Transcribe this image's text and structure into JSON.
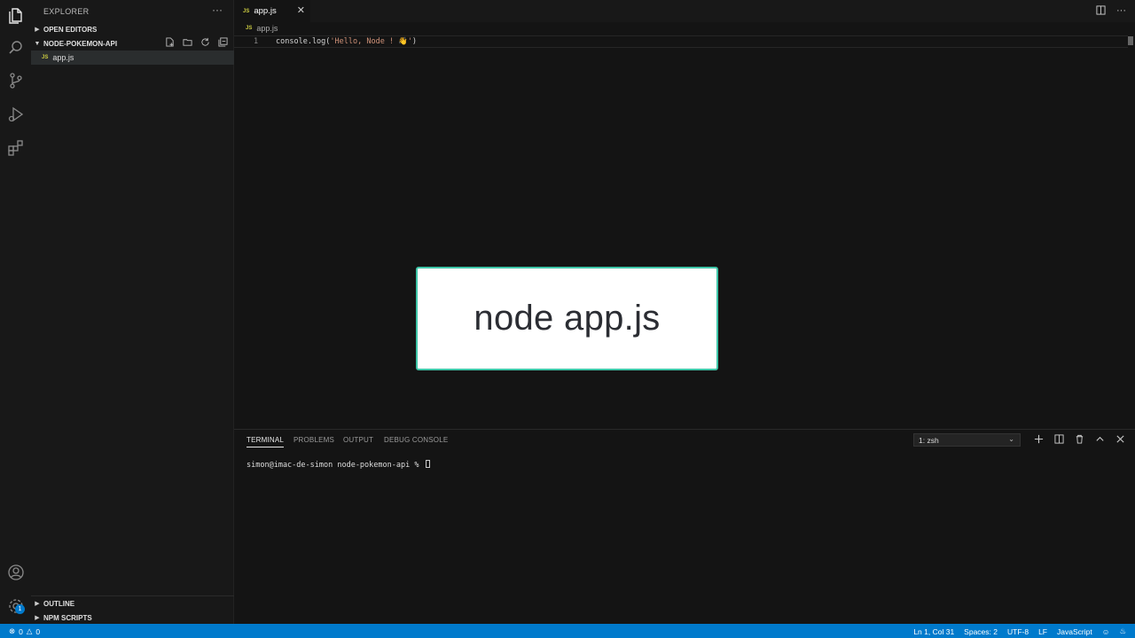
{
  "activity_bar": {
    "icons": [
      "files-icon",
      "search-icon",
      "source-control-icon",
      "run-debug-icon",
      "extensions-icon",
      "account-icon",
      "settings-gear-icon"
    ],
    "settings_badge": "1"
  },
  "sidebar": {
    "title": "EXPLORER",
    "more_actions": "···",
    "open_editors": "OPEN EDITORS",
    "project": "NODE-POKEMON-API",
    "files": [
      {
        "badge": "JS",
        "name": "app.js"
      }
    ],
    "outline": "OUTLINE",
    "npm_scripts": "NPM SCRIPTS"
  },
  "editor": {
    "tab": {
      "badge": "JS",
      "name": "app.js",
      "close": "✕"
    },
    "breadcrumb": {
      "badge": "JS",
      "name": "app.js"
    },
    "line_number": "1",
    "code": {
      "prefix": "console.log(",
      "string": "'Hello, Node ! 👋'",
      "suffix": ")"
    }
  },
  "overlay": {
    "text": "node app.js"
  },
  "panel": {
    "tabs": [
      "TERMINAL",
      "PROBLEMS",
      "OUTPUT",
      "DEBUG CONSOLE"
    ],
    "active_tab": "TERMINAL",
    "shell": "1: zsh",
    "prompt": "simon@imac-de-simon node-pokemon-api % "
  },
  "status_bar": {
    "errors": "0",
    "warnings": "0",
    "position": "Ln 1, Col 31",
    "spaces": "Spaces: 2",
    "encoding": "UTF-8",
    "eol": "LF",
    "language": "JavaScript"
  },
  "colors": {
    "accent": "#007acc",
    "overlay_border": "#3ec6a8",
    "js_badge": "#cbcb41"
  }
}
